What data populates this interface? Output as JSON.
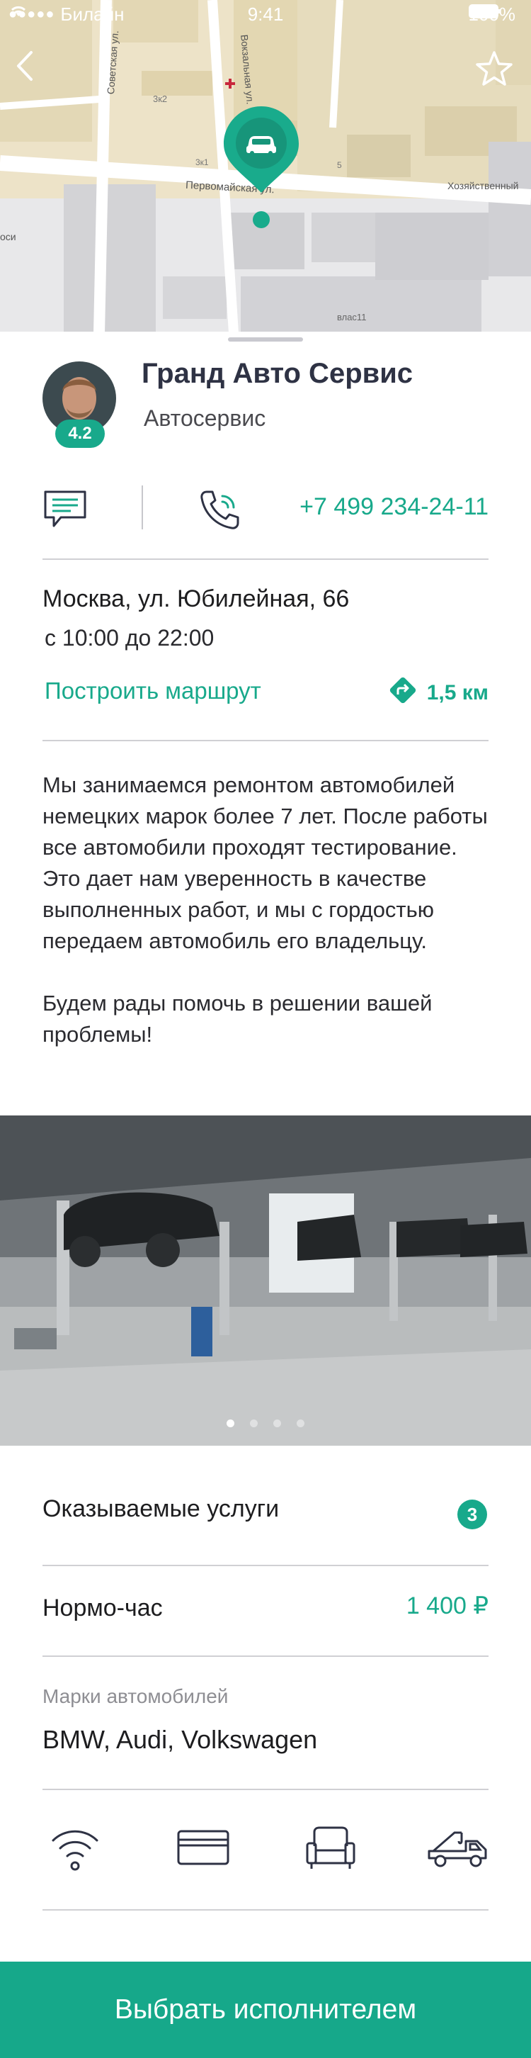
{
  "status_bar": {
    "carrier": "Билайн",
    "time": "9:41",
    "battery": "100%"
  },
  "map": {
    "street_pervomayskaya": "Первомайская ул.",
    "street_sovetskaya": "Советская ул.",
    "street_vokzalnaya": "Вокзальная ул.",
    "label_khozyaystvenny": "Хозяйственный",
    "label_vlas": "влас11",
    "label_3k2": "3к2",
    "label_3k1": "3к1",
    "label_5": "5",
    "label_si": "оси"
  },
  "icons": {
    "back": "back-arrow-icon",
    "favorite": "star-icon",
    "chat": "chat-icon",
    "call": "phone-icon",
    "route": "route-arrow-icon",
    "wifi": "wifi-icon",
    "card": "credit-card-icon",
    "waiting": "armchair-icon",
    "tow": "tow-truck-icon"
  },
  "colors": {
    "accent": "#18a98b",
    "title": "#2e3244",
    "divider": "#d0d0d4"
  },
  "company": {
    "name": "Гранд Авто Сервис",
    "category": "Автосервис",
    "rating": "4.2",
    "phone": "+7 499 234-24-11",
    "address": "Москва, ул. Юбилейная, 66",
    "hours": "с 10:00 до 22:00",
    "route_label": "Построить маршрут",
    "distance": "1,5 км",
    "description_1": "Мы занимаемся ремонтом автомобилей немецких марок более 7 лет. После работы все автомобили проходят тестирование. Это дает нам уверенность в качестве выполненных работ, и мы с гордостью передаем автомобиль его владельцу.",
    "description_2": "Будем рады помочь в решении вашей проблемы!"
  },
  "gallery": {
    "pages": 4,
    "active_page": 1
  },
  "details": {
    "services_label": "Оказываемые услуги",
    "services_count": "3",
    "norm_hour_label": "Нормо-час",
    "norm_hour_price": "1 400 ₽",
    "brands_label": "Марки автомобилей",
    "brands": "BMW, Audi, Volkswagen"
  },
  "cta": {
    "label": "Выбрать исполнителем"
  }
}
